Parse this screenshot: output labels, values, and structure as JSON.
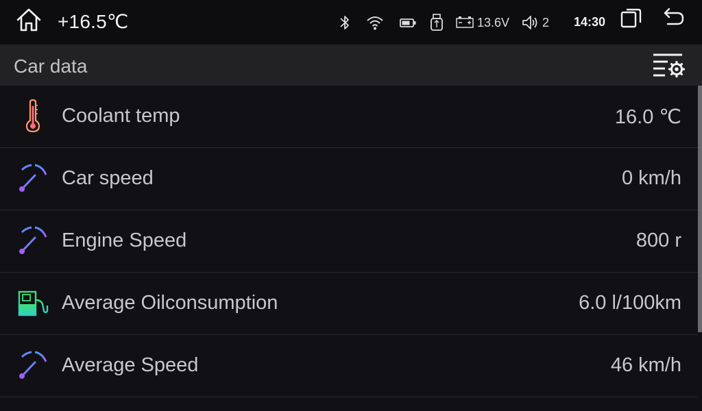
{
  "status": {
    "outside_temp": "+16.5℃",
    "voltage": "13.6V",
    "volume": "2",
    "clock": "14:30",
    "icons": {
      "home": "home-icon",
      "bluetooth": "bluetooth-icon",
      "wifi": "wifi-icon",
      "battery": "battery-icon",
      "usb": "usb-icon",
      "car_battery": "car-battery-icon",
      "speaker": "speaker-icon",
      "recent_apps": "recent-apps-icon",
      "back": "back-icon"
    }
  },
  "header": {
    "title": "Car data",
    "settings_icon": "list-settings-icon"
  },
  "items": [
    {
      "label": "Coolant temp",
      "value": "16.0 ℃",
      "icon": "thermometer-icon"
    },
    {
      "label": "Car speed",
      "value": "0 km/h",
      "icon": "gauge-icon"
    },
    {
      "label": "Engine Speed",
      "value": "800 r",
      "icon": "gauge-icon"
    },
    {
      "label": "Average Oilconsumption",
      "value": "6.0 l/100km",
      "icon": "fuel-pump-icon"
    },
    {
      "label": "Average Speed",
      "value": "46 km/h",
      "icon": "gauge-icon"
    }
  ],
  "colors": {
    "background": "#111014",
    "statusbar": "#0d0d10",
    "titlebar": "#222225",
    "text": "#c8c8cb",
    "gauge_start": "#3aa0ff",
    "gauge_end": "#a35cff",
    "thermo": "#ff9a6a",
    "fuel": "#3ee07a"
  }
}
